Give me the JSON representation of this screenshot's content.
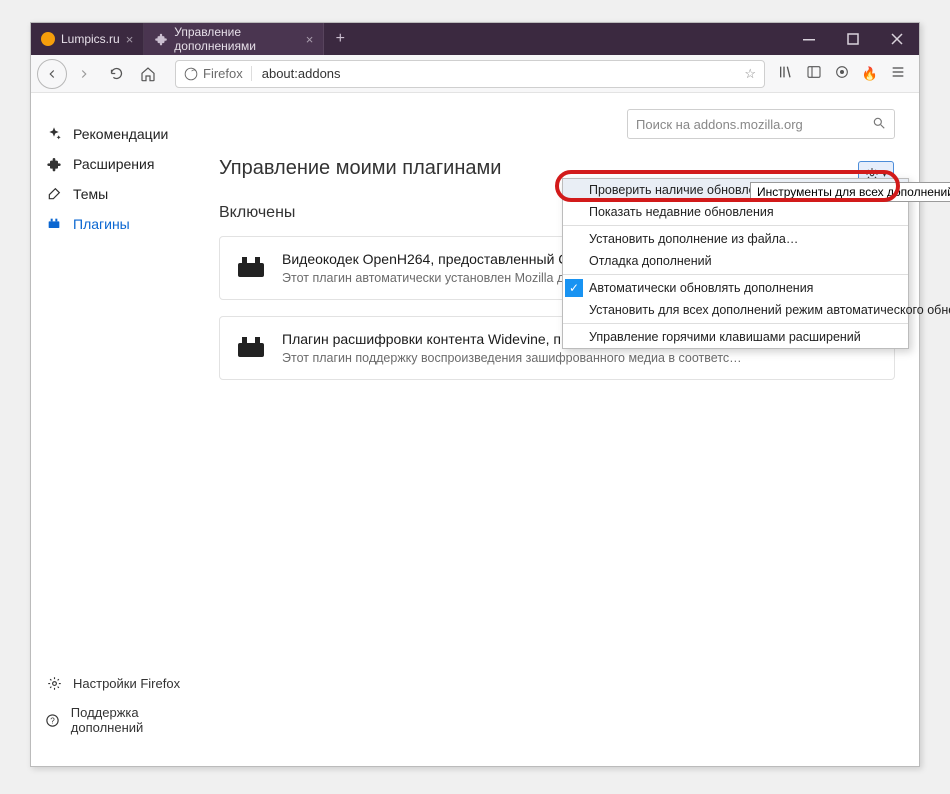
{
  "tabs": {
    "inactive": {
      "title": "Lumpics.ru"
    },
    "active": {
      "title": "Управление дополнениями"
    }
  },
  "url": {
    "identity": "Firefox",
    "value": "about:addons"
  },
  "sidebar": {
    "items": [
      {
        "label": "Рекомендации"
      },
      {
        "label": "Расширения"
      },
      {
        "label": "Темы"
      },
      {
        "label": "Плагины"
      }
    ],
    "footer": [
      {
        "label": "Настройки Firefox"
      },
      {
        "label": "Поддержка дополнений"
      }
    ]
  },
  "search": {
    "placeholder": "Поиск на addons.mozilla.org"
  },
  "headings": {
    "page": "Управление моими плагинами",
    "section": "Включены"
  },
  "plugins": [
    {
      "name": "Видеокодек OpenH264, предоставленный C",
      "desc": "Этот плагин автоматически установлен Mozilla для"
    },
    {
      "name": "Плагин расшифровки контента Widevine, п",
      "desc": "Этот плагин поддержку воспроизведения зашифрованного медиа в соответс…"
    }
  ],
  "dropdown": {
    "items": [
      "Проверить наличие обновлений",
      "Показать недавние обновления",
      "Установить дополнение из файла…",
      "Отладка дополнений",
      "Автоматически обновлять дополнения",
      "Установить для всех дополнений режим автоматического обновления",
      "Управление горячими клавишами расширений"
    ]
  },
  "tooltip": "Инструменты для всех дополнений"
}
